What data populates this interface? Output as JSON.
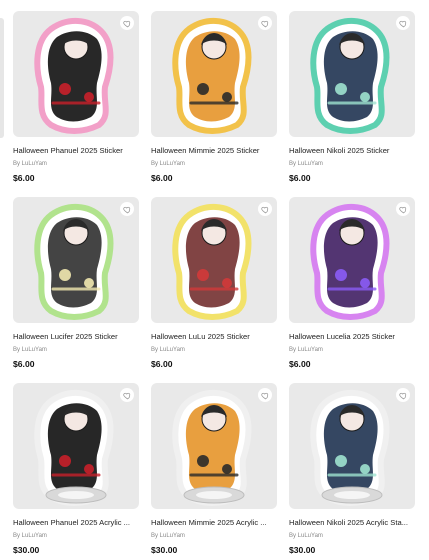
{
  "products": [
    {
      "title": "Halloween Phanuel 2025 Sticker",
      "by": "By LuLuYam",
      "price": "$6.00",
      "palette": {
        "outline": "#f2a0c8",
        "body": "#1c1c1c",
        "accent": "#c8202a"
      }
    },
    {
      "title": "Halloween Mimmie 2025 Sticker",
      "by": "By LuLuYam",
      "price": "$6.00",
      "palette": {
        "outline": "#f2c24a",
        "body": "#e79a35",
        "accent": "#2a2a2a"
      }
    },
    {
      "title": "Halloween Nikoli 2025 Sticker",
      "by": "By LuLuYam",
      "price": "$6.00",
      "palette": {
        "outline": "#5dd0b0",
        "body": "#2a3d5a",
        "accent": "#9fe2cf"
      }
    },
    {
      "title": "Halloween Lucifer 2025 Sticker",
      "by": "By LuLuYam",
      "price": "$6.00",
      "palette": {
        "outline": "#b1e38d",
        "body": "#3a3a3a",
        "accent": "#f2e9b0"
      }
    },
    {
      "title": "Halloween LuLu 2025 Sticker",
      "by": "By LuLuYam",
      "price": "$6.00",
      "palette": {
        "outline": "#f2e26a",
        "body": "#7a3a3a",
        "accent": "#d23a3a"
      }
    },
    {
      "title": "Halloween Lucelia 2025 Sticker",
      "by": "By LuLuYam",
      "price": "$6.00",
      "palette": {
        "outline": "#d784f0",
        "body": "#4a2a6a",
        "accent": "#8b5cf6"
      }
    },
    {
      "title": "Halloween Phanuel 2025 Acrylic ...",
      "by": "By LuLuYam",
      "price": "$30.00",
      "palette": {
        "outline": "#f0f0f0",
        "body": "#1b1b1b",
        "accent": "#c8202a"
      }
    },
    {
      "title": "Halloween Mimmie 2025 Acrylic ...",
      "by": "By LuLuYam",
      "price": "$30.00",
      "palette": {
        "outline": "#f0f0f0",
        "body": "#e79a35",
        "accent": "#2a2a2a"
      }
    },
    {
      "title": "Halloween Nikoli 2025 Acrylic Sta...",
      "by": "By LuLuYam",
      "price": "$30.00",
      "palette": {
        "outline": "#f0f0f0",
        "body": "#2a3d5a",
        "accent": "#9fe2cf"
      }
    }
  ],
  "icons": {
    "favorite": "heart-icon"
  }
}
